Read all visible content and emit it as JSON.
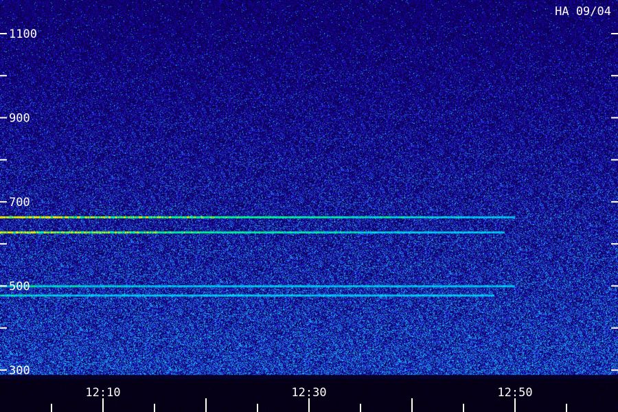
{
  "header": {
    "label": "HA 09/04"
  },
  "chart_data": {
    "type": "heatmap",
    "title": "",
    "xlabel": "",
    "ylabel": "",
    "x_tick_labels": [
      "12:10",
      "12:30",
      "12:50"
    ],
    "x_ticks_minutes": [
      10,
      30,
      50
    ],
    "xlim_minutes": [
      0,
      60
    ],
    "y_tick_labels": [
      "1100",
      "900",
      "700",
      "500",
      "300"
    ],
    "y_ticks": [
      1100,
      900,
      700,
      500,
      300
    ],
    "ylim": [
      290,
      1180
    ],
    "grid": false,
    "series": [
      {
        "y": 664,
        "x_start_min": 0,
        "x_end_min": 50,
        "intensity": 1.0
      },
      {
        "y": 628,
        "x_start_min": 0,
        "x_end_min": 49,
        "intensity": 0.95
      },
      {
        "y": 500,
        "x_start_min": 0,
        "x_end_min": 50,
        "intensity": 0.6
      },
      {
        "y": 478,
        "x_start_min": 0,
        "x_end_min": 48,
        "intensity": 0.55
      }
    ],
    "colors": {
      "background": "#0a0a5a",
      "noise": "#2a2aff",
      "mid": "#00c0ff",
      "high": "#e0ff00"
    }
  }
}
